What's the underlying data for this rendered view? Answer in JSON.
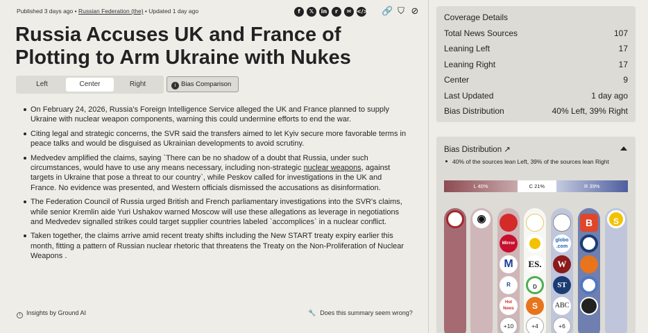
{
  "meta": {
    "published": "Published 3 days ago •",
    "source": "Russian Federation (the)",
    "updated": "• Updated 1 day ago"
  },
  "share_icons": [
    "facebook-icon",
    "x-icon",
    "linkedin-icon",
    "reddit-icon",
    "email-icon",
    "embed-icon"
  ],
  "tool_icons": [
    "link-icon",
    "bookmark-icon",
    "block-icon"
  ],
  "title": "Russia Accuses UK and France of Plotting to Arm Ukraine with Nukes",
  "tabs": [
    {
      "label": "Left",
      "active": false
    },
    {
      "label": "Center",
      "active": true
    },
    {
      "label": "Right",
      "active": false
    }
  ],
  "bias_comparison_label": "Bias Comparison",
  "bullets": [
    {
      "text": "On February 24, 2026, Russia's Foreign Intelligence Service alleged the UK and France planned to supply Ukraine with nuclear weapon components, warning this could undermine efforts to end the war."
    },
    {
      "text": "Citing legal and strategic concerns, the SVR said the transfers aimed to let Kyiv secure more favorable terms in peace talks and would be disguised as Ukrainian developments to avoid scrutiny."
    },
    {
      "pre": "Medvedev amplified the claims, saying `There can be no shadow of a doubt that Russia, under such circumstances, would have to use any means necessary, including non-strategic ",
      "link": "nuclear weapons",
      "post": ", against targets in Ukraine that pose a threat to our country`, while Peskov called for investigations in the UK and France. No evidence was presented, and Western officials dismissed the accusations as disinformation."
    },
    {
      "text": "The Federation Council of Russia urged British and French parliamentary investigations into the SVR's claims, while senior Kremlin aide Yuri Ushakov warned Moscow will use these allegations as leverage in negotiations and Medvedev signalled strikes could target supplier countries labeled `accomplices` in a nuclear conflict."
    },
    {
      "text": "Taken together, the claims arrive amid recent treaty shifts including the New START treaty expiry earlier this month, fitting a pattern of Russian nuclear rhetoric that threatens the Treaty on the Non-Proliferation of Nuclear Weapons ."
    }
  ],
  "insights_label": "Insights by Ground AI",
  "feedback_label": "Does this summary seem wrong?",
  "coverage": {
    "heading": "Coverage Details",
    "rows": [
      {
        "label": "Total News Sources",
        "value": "107"
      },
      {
        "label": "Leaning Left",
        "value": "17"
      },
      {
        "label": "Leaning Right",
        "value": "17"
      },
      {
        "label": "Center",
        "value": "9"
      },
      {
        "label": "Last Updated",
        "value": "1 day ago"
      },
      {
        "label": "Bias Distribution",
        "value": "40% Left, 39% Right"
      }
    ]
  },
  "bias_distribution": {
    "heading": "Bias Distribution ↗",
    "note": "40% of the sources lean Left, 39% of the sources lean Right",
    "left_label": "L 40%",
    "center_label": "C 21%",
    "right_label": "R 39%",
    "left_pct": 40,
    "center_pct": 21,
    "right_pct": 39,
    "colors": {
      "left": "#8d4b53",
      "center": "#ffffff",
      "right": "#4e5e9e"
    },
    "sources": {
      "far_left": [
        {
          "text": "",
          "color": "#a3282f"
        }
      ],
      "left": [
        {
          "text": "◉",
          "color": "#ffffff"
        }
      ],
      "lean_left": [
        {
          "text": "",
          "color": "#d42a2a"
        },
        {
          "text": "Mirror",
          "color": "#c8102e"
        },
        {
          "text": "M",
          "color": "#1f3f9a"
        },
        {
          "text": "R",
          "color": "#ffffff"
        },
        {
          "text": "Hot News",
          "color": "#ffffff"
        }
      ],
      "lean_left_more": "+10",
      "center": [
        {
          "text": "",
          "color": "#ffffff"
        },
        {
          "text": "",
          "color": "#f2c200"
        },
        {
          "text": "ES.",
          "color": "#ffffff"
        },
        {
          "text": "D",
          "color": "#ffffff"
        },
        {
          "text": "S",
          "color": "#e8741b"
        }
      ],
      "center_more": "+4",
      "lean_right": [
        {
          "text": "",
          "color": "#ffffff"
        },
        {
          "text": "globo .com",
          "color": "#ffffff"
        },
        {
          "text": "W",
          "color": "#8b1a1a"
        },
        {
          "text": "ST",
          "color": "#1a3c73"
        },
        {
          "text": "ABC",
          "color": "#ffffff"
        }
      ],
      "lean_right_more": "+6",
      "right": [
        {
          "text": "B",
          "color": "#e0462b"
        },
        {
          "text": "",
          "color": "#ffffff"
        },
        {
          "text": "",
          "color": "#e8741b"
        },
        {
          "text": "",
          "color": "#ffffff"
        },
        {
          "text": "",
          "color": "#222222"
        }
      ],
      "far_right": [
        {
          "text": "S",
          "color": "#f2c200"
        }
      ]
    }
  }
}
